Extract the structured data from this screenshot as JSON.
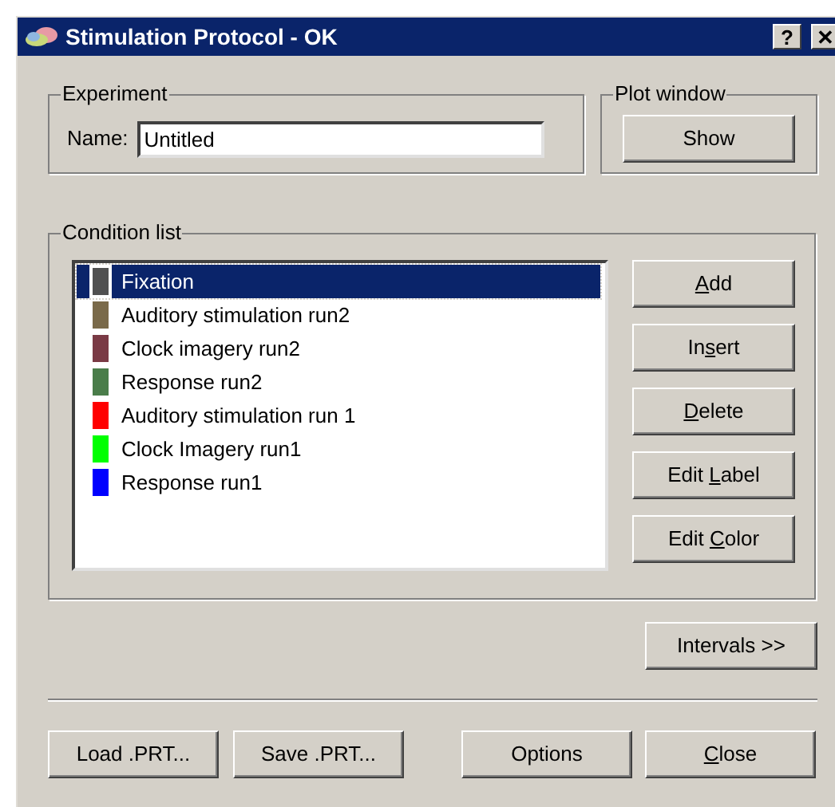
{
  "window": {
    "title": "Stimulation Protocol - OK",
    "title_buttons": [
      "?",
      "✕"
    ]
  },
  "experiment": {
    "legend": "Experiment",
    "name_label": "Name:",
    "name_value": "Untitled"
  },
  "plot_window": {
    "legend": "Plot window",
    "button": {
      "label": "Show"
    }
  },
  "condition_list": {
    "legend": "Condition list",
    "items": [
      {
        "label": "Fixation",
        "color": "#505050",
        "selected": true
      },
      {
        "label": "Auditory stimulation run2",
        "color": "#7a6a4a",
        "selected": false
      },
      {
        "label": "Clock imagery run2",
        "color": "#7a3a45",
        "selected": false
      },
      {
        "label": "Response run2",
        "color": "#4a7d4a",
        "selected": false
      },
      {
        "label": "Auditory stimulation run 1",
        "color": "#ff0000",
        "selected": false
      },
      {
        "label": "Clock Imagery run1",
        "color": "#00ff00",
        "selected": false
      },
      {
        "label": "Response run1",
        "color": "#0000ff",
        "selected": false
      }
    ],
    "buttons": [
      {
        "mnemonic": "A",
        "label_after": "dd"
      },
      {
        "label_before": "In",
        "mnemonic": "s",
        "label_after": "ert"
      },
      {
        "mnemonic": "D",
        "label_after": "elete"
      },
      {
        "label_before": "Edit ",
        "mnemonic": "L",
        "label_after": "abel"
      },
      {
        "label_before": "Edit ",
        "mnemonic": "C",
        "label_after": "olor"
      }
    ]
  },
  "intervals_button": {
    "label": "Intervals >>"
  },
  "bottom_buttons": [
    {
      "label": "Load .PRT..."
    },
    {
      "label": "Save .PRT..."
    },
    {
      "label": "Options"
    },
    {
      "mnemonic": "C",
      "label_after": "lose"
    }
  ]
}
